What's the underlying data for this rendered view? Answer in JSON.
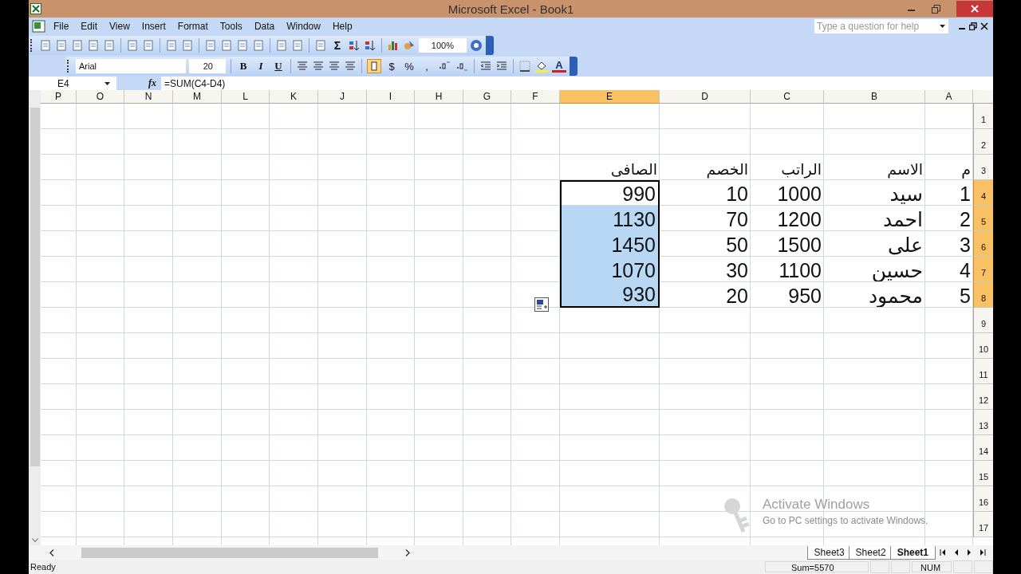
{
  "window": {
    "title": "Microsoft Excel - Book1"
  },
  "menu": [
    "File",
    "Edit",
    "View",
    "Insert",
    "Format",
    "Tools",
    "Data",
    "Window",
    "Help"
  ],
  "help_search": {
    "placeholder": "Type a question for help"
  },
  "standard_toolbar": {
    "sum_glyph": "Σ",
    "zoom": "100%"
  },
  "formatting_toolbar": {
    "font": "Arial",
    "size": "20",
    "bold": "B",
    "italic": "I",
    "underline": "U",
    "currency": "$",
    "percent": "%",
    "comma": ",",
    "font_color_glyph": "A"
  },
  "formula_bar": {
    "name_box": "E4",
    "function_label": "fx",
    "formula": "=SUM(C4-D4)"
  },
  "sheet": {
    "columns": [
      {
        "label": "P",
        "selected": false
      },
      {
        "label": "O",
        "selected": false
      },
      {
        "label": "N",
        "selected": false
      },
      {
        "label": "M",
        "selected": false
      },
      {
        "label": "L",
        "selected": false
      },
      {
        "label": "K",
        "selected": false
      },
      {
        "label": "J",
        "selected": false
      },
      {
        "label": "I",
        "selected": false
      },
      {
        "label": "H",
        "selected": false
      },
      {
        "label": "G",
        "selected": false
      },
      {
        "label": "F",
        "selected": false
      },
      {
        "label": "E",
        "selected": true
      },
      {
        "label": "D",
        "selected": false
      },
      {
        "label": "C",
        "selected": false
      },
      {
        "label": "B",
        "selected": false
      },
      {
        "label": "A",
        "selected": false
      }
    ],
    "rows": [
      {
        "label": "1",
        "selected": false
      },
      {
        "label": "2",
        "selected": false
      },
      {
        "label": "3",
        "selected": false,
        "header_cells": [
          "م",
          "الاسم",
          "الراتب",
          "الخصم",
          "الصافى"
        ]
      },
      {
        "label": "4",
        "selected": true,
        "cells": [
          "990",
          "10",
          "1000",
          "سيد",
          "1"
        ]
      },
      {
        "label": "5",
        "selected": true,
        "cells": [
          "1130",
          "70",
          "1200",
          "احمد",
          "2"
        ]
      },
      {
        "label": "6",
        "selected": true,
        "cells": [
          "1450",
          "50",
          "1500",
          "على",
          "3"
        ]
      },
      {
        "label": "7",
        "selected": true,
        "cells": [
          "1070",
          "30",
          "1100",
          "حسين",
          "4"
        ]
      },
      {
        "label": "8",
        "selected": true,
        "cells": [
          "930",
          "20",
          "950",
          "محمود",
          "5"
        ]
      },
      {
        "label": "9",
        "selected": false
      },
      {
        "label": "10",
        "selected": false
      },
      {
        "label": "11",
        "selected": false
      },
      {
        "label": "12",
        "selected": false
      },
      {
        "label": "13",
        "selected": false
      },
      {
        "label": "14",
        "selected": false
      },
      {
        "label": "15",
        "selected": false
      },
      {
        "label": "16",
        "selected": false
      },
      {
        "label": "17",
        "selected": false
      }
    ]
  },
  "sheet_tabs": [
    {
      "label": "Sheet3",
      "selected": false
    },
    {
      "label": "Sheet2",
      "selected": false
    },
    {
      "label": "Sheet1",
      "selected": true
    }
  ],
  "activation_notice": {
    "title": "Activate Windows",
    "text": "Go to PC settings to activate Windows."
  },
  "status_bar": {
    "state": "Ready",
    "sum": "Sum=5570",
    "num": "NUM"
  }
}
